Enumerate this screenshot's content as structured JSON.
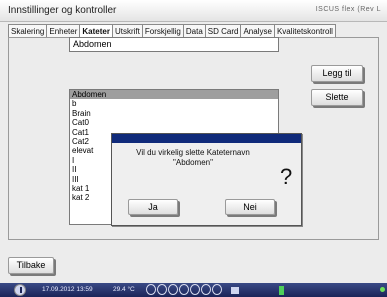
{
  "window": {
    "title": "Innstillinger og kontroller",
    "brand": "ISCUS flex (Rev L"
  },
  "tabs": [
    {
      "label": "Skalering"
    },
    {
      "label": "Enheter"
    },
    {
      "label": "Kateter"
    },
    {
      "label": "Utskrift"
    },
    {
      "label": "Forskjellig"
    },
    {
      "label": "Data"
    },
    {
      "label": "SD Card"
    },
    {
      "label": "Analyse"
    },
    {
      "label": "Kvalitetskontroll"
    }
  ],
  "catheter": {
    "name_value": "Abdomen",
    "add_label": "Legg til",
    "delete_label": "Slette",
    "list_items": [
      "Abdomen",
      "b",
      "Brain",
      "Cat0",
      "Cat1",
      "Cat2",
      "elevat",
      "I",
      "II",
      "III",
      "kat 1",
      "kat 2"
    ],
    "selected_index": 0
  },
  "dialog": {
    "message": "Vil du virkelig slette Kateternavn \"Abdomen\"",
    "question_icon": "?",
    "yes_label": "Ja",
    "no_label": "Nei"
  },
  "footer": {
    "back_label": "Tilbake"
  },
  "statusbar": {
    "datetime": "17.09.2012 13:59",
    "temperature": "29.4 °C"
  },
  "colors": {
    "dialog_titlebar": "#102a7a",
    "statusbar": "#1b2458",
    "selection": "#9e9e9e"
  }
}
